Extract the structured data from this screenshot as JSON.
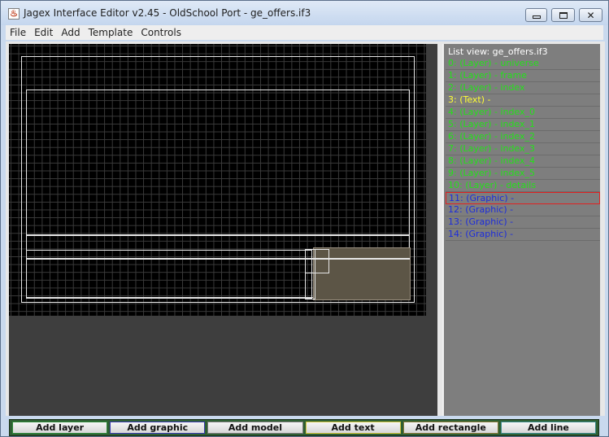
{
  "window": {
    "title": "Jagex Interface Editor v2.45 - OldSchool Port - ge_offers.if3",
    "icon": "java-icon",
    "icon_glyph": "♨"
  },
  "menubar": {
    "items": [
      "File",
      "Edit",
      "Add",
      "Template",
      "Controls"
    ]
  },
  "list_view": {
    "title": "List view: ge_offers.if3",
    "items": [
      {
        "label": "0: (Layer) - universe",
        "kind": "layer"
      },
      {
        "label": "1: (Layer) - frame",
        "kind": "layer"
      },
      {
        "label": "2: (Layer) - index",
        "kind": "layer"
      },
      {
        "label": "3: (Text) -",
        "kind": "text"
      },
      {
        "label": "4: (Layer) - index_0",
        "kind": "layer"
      },
      {
        "label": "5: (Layer) - index_1",
        "kind": "layer"
      },
      {
        "label": "6: (Layer) - index_2",
        "kind": "layer"
      },
      {
        "label": "7: (Layer) - index_3",
        "kind": "layer"
      },
      {
        "label": "8: (Layer) - index_4",
        "kind": "layer"
      },
      {
        "label": "9: (Layer) - index_5",
        "kind": "layer"
      },
      {
        "label": "10: (Layer) - details",
        "kind": "layer"
      },
      {
        "label": "11: (Graphic) -",
        "kind": "graphic",
        "selected": true
      },
      {
        "label": "12: (Graphic) -",
        "kind": "graphic"
      },
      {
        "label": "13: (Graphic) -",
        "kind": "graphic"
      },
      {
        "label": "14: (Graphic) -",
        "kind": "graphic"
      }
    ]
  },
  "toolbar": {
    "buttons": [
      "Add layer",
      "Add graphic",
      "Add model",
      "Add text",
      "Add rectangle",
      "Add line"
    ]
  },
  "colors": {
    "layer": "#24e01a",
    "text": "#ffff33",
    "graphic": "#1d2ddb",
    "selection": "#e02020",
    "canvas": "#000000",
    "toolbar": "#2e5f33"
  }
}
